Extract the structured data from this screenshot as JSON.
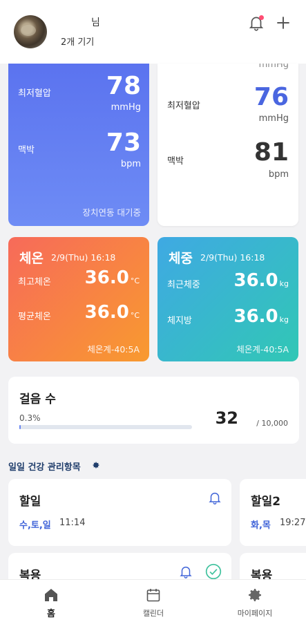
{
  "header": {
    "user_name": "님",
    "device_count": "2개 기기"
  },
  "bp_left": {
    "min_label": "최저혈압",
    "min_value": "78",
    "min_unit": "mmHg",
    "pulse_label": "맥박",
    "pulse_value": "73",
    "pulse_unit": "bpm",
    "footer": "장치연동 대기중"
  },
  "bp_right": {
    "top_unit": "mmHg",
    "min_label": "최저혈압",
    "min_value": "76",
    "min_unit": "mmHg",
    "pulse_label": "맥박",
    "pulse_value": "81",
    "pulse_unit": "bpm"
  },
  "temperature": {
    "title": "체온",
    "date": "2/9(Thu) 16:18",
    "max_label": "최고체온",
    "max_value": "36.0",
    "avg_label": "평균체온",
    "avg_value": "36.0",
    "unit": "°C",
    "device": "체온계-40:5A"
  },
  "weight": {
    "title": "체중",
    "date": "2/9(Thu) 16:18",
    "recent_label": "최근체중",
    "recent_value": "36.0",
    "fat_label": "체지방",
    "fat_value": "36.0",
    "unit": "kg",
    "device": "체온계-40:5A"
  },
  "steps": {
    "title": "걸음 수",
    "percent": "0.3%",
    "progress_fraction": 0.003,
    "count": "32",
    "goal": "/ 10,000"
  },
  "daily_section": {
    "title": "일일 건강 관리항목"
  },
  "todos": [
    {
      "title": "할일",
      "days": "수,토,일",
      "time": "11:14"
    },
    {
      "title": "할일2",
      "days": "화,목",
      "time": "19:27"
    },
    {
      "title": "복용"
    },
    {
      "title": "복용"
    }
  ],
  "tabs": [
    {
      "label": "홈",
      "icon": "home-icon"
    },
    {
      "label": "캘린더",
      "icon": "calendar-icon"
    },
    {
      "label": "마이페이지",
      "icon": "gear-icon"
    }
  ],
  "colors": {
    "accent": "#5b73ef",
    "bell_dot": "#ff4d73",
    "temp_gradient": [
      "#f76a5a",
      "#f89a2f"
    ],
    "weight_gradient": [
      "#3fa9e3",
      "#31c7b5"
    ]
  }
}
